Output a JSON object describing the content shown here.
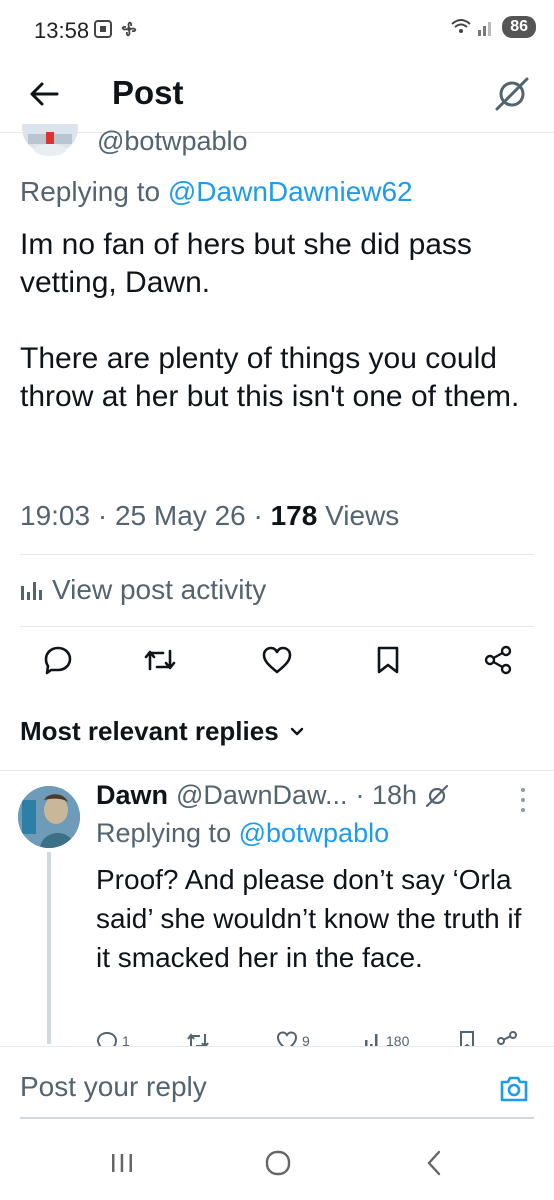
{
  "status_bar": {
    "time": "13:58",
    "battery": "86",
    "signal_icon": "wifi-signal-icon"
  },
  "app_bar": {
    "title": "Post",
    "back_icon": "back-arrow-icon",
    "grok_icon": "grok-icon"
  },
  "post": {
    "handle": "@botwpablo",
    "replying_prefix": "Replying to ",
    "replying_to": "@DawnDawniew62",
    "text": "Im no fan of hers but she did pass vetting, Dawn.\n\nThere are plenty of things you could throw at her but this isn't one of them.",
    "time": "19:03",
    "date": "25 May 26",
    "views_count": "178",
    "views_label": "Views",
    "activity_label": "View post activity"
  },
  "actions": [
    "reply-icon",
    "repost-icon",
    "like-icon",
    "bookmark-icon",
    "share-icon"
  ],
  "replies_section": {
    "label": "Most relevant replies"
  },
  "reply": {
    "name": "Dawn",
    "handle": "@DawnDaw...",
    "time": "· 18h",
    "replying_prefix": "Replying to ",
    "replying_to": "@botwpablo",
    "text": "Proof? And please don’t say ‘Orla said’ she wouldn’t know the truth if it smacked her in the face.",
    "counts": {
      "replies": "1",
      "likes": "9",
      "views": "180"
    },
    "accent": "#1d9bf0"
  },
  "composer": {
    "placeholder": "Post your reply"
  },
  "colors": {
    "text": "#0f1419",
    "secondary": "#536471",
    "link": "#1d9bf0",
    "divider": "#e6e9eb"
  }
}
